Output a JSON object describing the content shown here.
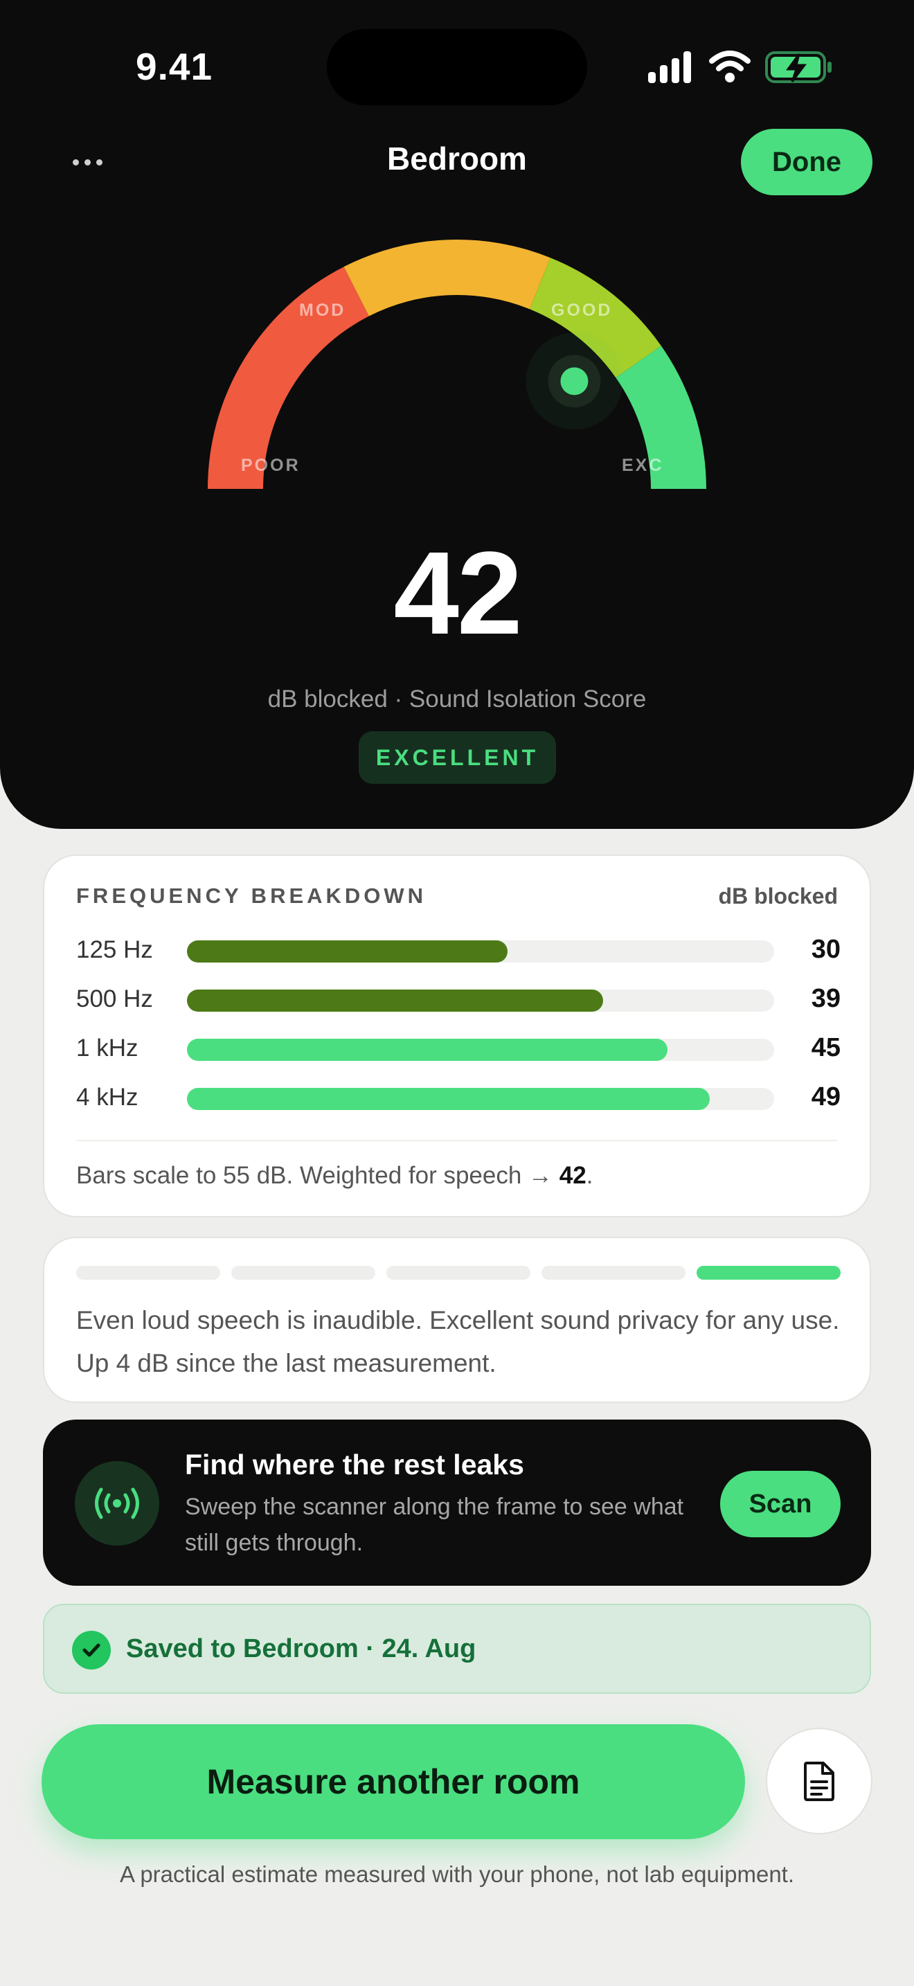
{
  "status_bar": {
    "time": "9.41"
  },
  "header": {
    "more_label": "More options",
    "title": "Bedroom",
    "done_label": "Done"
  },
  "gauge": {
    "labels": [
      "POOR",
      "MOD",
      "GOOD",
      "EXC"
    ],
    "colors": [
      "#f05a3f",
      "#f2b431",
      "#a5cf2a",
      "#4ade80"
    ],
    "scale_max": 55,
    "value": 42
  },
  "score": {
    "value": "42",
    "subtitle": "dB blocked · Sound Isolation Score",
    "rating": "EXCELLENT"
  },
  "frequency": {
    "title": "FREQUENCY BREAKDOWN",
    "unit_label": "dB blocked",
    "scale_max_db": 55,
    "rows": [
      {
        "label": "125 Hz",
        "value": "30",
        "db": 30,
        "color": "#4d7a17"
      },
      {
        "label": "500 Hz",
        "value": "39",
        "db": 39,
        "color": "#4d7a17"
      },
      {
        "label": "1 kHz",
        "value": "45",
        "db": 45,
        "color": "#4ade80"
      },
      {
        "label": "4 kHz",
        "value": "49",
        "db": 49,
        "color": "#4ade80"
      }
    ],
    "note_prefix": "Bars scale to 55 dB. Weighted for speech → ",
    "note_value": "42",
    "note_suffix": "."
  },
  "verdict": {
    "segments_total": 5,
    "active_segment": 5,
    "active_color": "#4ade80",
    "text": "Even loud speech is inaudible. Excellent sound privacy for any use. Up 4 dB since the last measurement."
  },
  "scan": {
    "icon": "broadcast-icon",
    "title": "Find where the rest leaks",
    "description": "Sweep the scanner along the frame to see what still gets through.",
    "button_label": "Scan"
  },
  "saved": {
    "text": "Saved to Bedroom · 24. Aug"
  },
  "actions": {
    "measure_label": "Measure another room",
    "report_icon": "document-icon"
  },
  "footer": {
    "disclaimer": "A practical estimate measured with your phone, not lab equipment."
  }
}
